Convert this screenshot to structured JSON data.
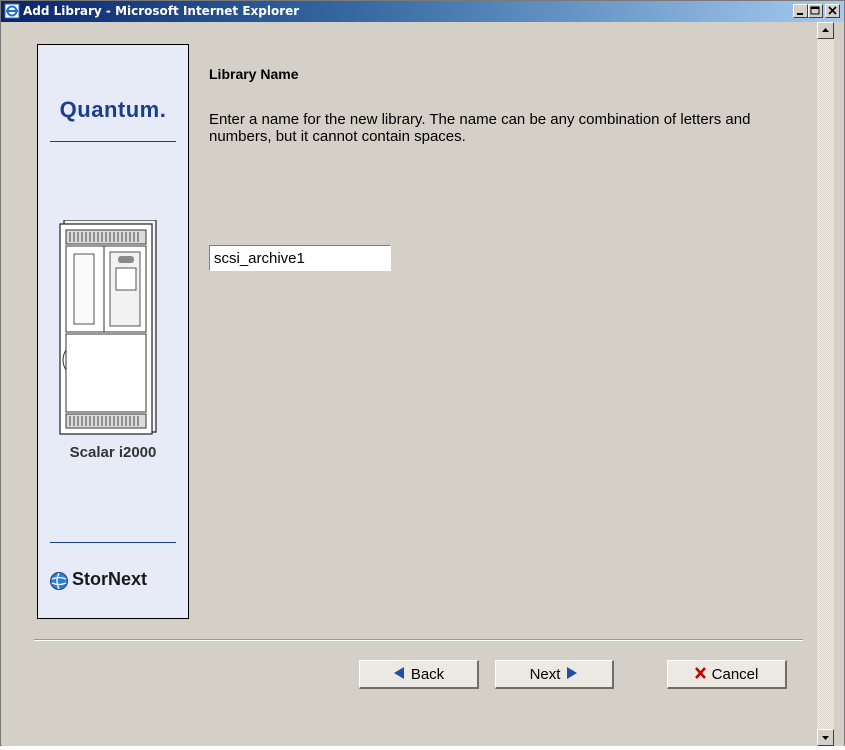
{
  "window": {
    "title": "Add Library - Microsoft Internet Explorer"
  },
  "sidebar": {
    "brand": "Quantum.",
    "product": "Scalar i2000",
    "footer_brand": "StorNext"
  },
  "form": {
    "section_title": "Library Name",
    "instructions": "Enter a name for the new library. The name can be any combination of letters and numbers, but it cannot contain spaces.",
    "library_name_value": "scsi_archive1"
  },
  "buttons": {
    "back_label": "Back",
    "next_label": "Next",
    "cancel_label": "Cancel"
  },
  "colors": {
    "titlebar_start": "#0a246a",
    "titlebar_end": "#a6caf0",
    "panel_bg": "#e7ebf8",
    "brand_blue": "#1b3f8f",
    "nav_arrow": "#1f4fa8",
    "cancel_x": "#cc0000"
  },
  "icons": {
    "title": "ie-page-icon",
    "back": "left-triangle-icon",
    "next": "right-triangle-icon",
    "cancel": "red-x-icon",
    "stornext": "globe-icon"
  }
}
